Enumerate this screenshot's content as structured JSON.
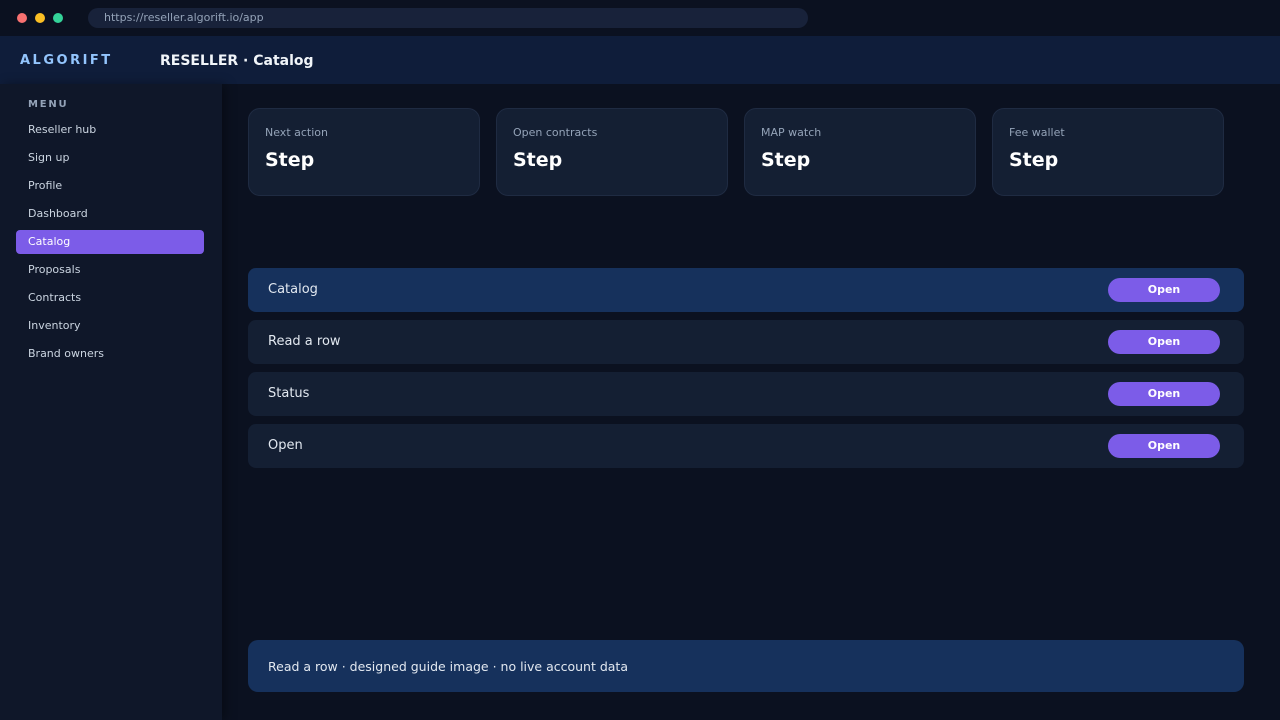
{
  "browser": {
    "url": "https://reseller.algorift.io/app"
  },
  "header": {
    "brand": "ALGORIFT",
    "breadcrumb": "RESELLER · Catalog"
  },
  "sidebar": {
    "section_label": "MENU",
    "items": [
      {
        "label": "Reseller hub"
      },
      {
        "label": "Sign up"
      },
      {
        "label": "Profile"
      },
      {
        "label": "Dashboard"
      },
      {
        "label": "Catalog",
        "active": true
      },
      {
        "label": "Proposals"
      },
      {
        "label": "Contracts"
      },
      {
        "label": "Inventory"
      },
      {
        "label": "Brand owners"
      }
    ]
  },
  "cards": [
    {
      "label": "Next action",
      "value": "Step"
    },
    {
      "label": "Open contracts",
      "value": "Step"
    },
    {
      "label": "MAP watch",
      "value": "Step"
    },
    {
      "label": "Fee wallet",
      "value": "Step"
    }
  ],
  "rows": [
    {
      "label": "Catalog",
      "button": "Open",
      "highlighted": true
    },
    {
      "label": "Read a row",
      "button": "Open"
    },
    {
      "label": "Status",
      "button": "Open"
    },
    {
      "label": "Open",
      "button": "Open"
    }
  ],
  "footer": {
    "note": "Read a row · designed guide image · no live account data"
  },
  "colors": {
    "accent": "#7c5ce8",
    "brand": "#93c5fd",
    "highlight_row": "#16315c"
  }
}
